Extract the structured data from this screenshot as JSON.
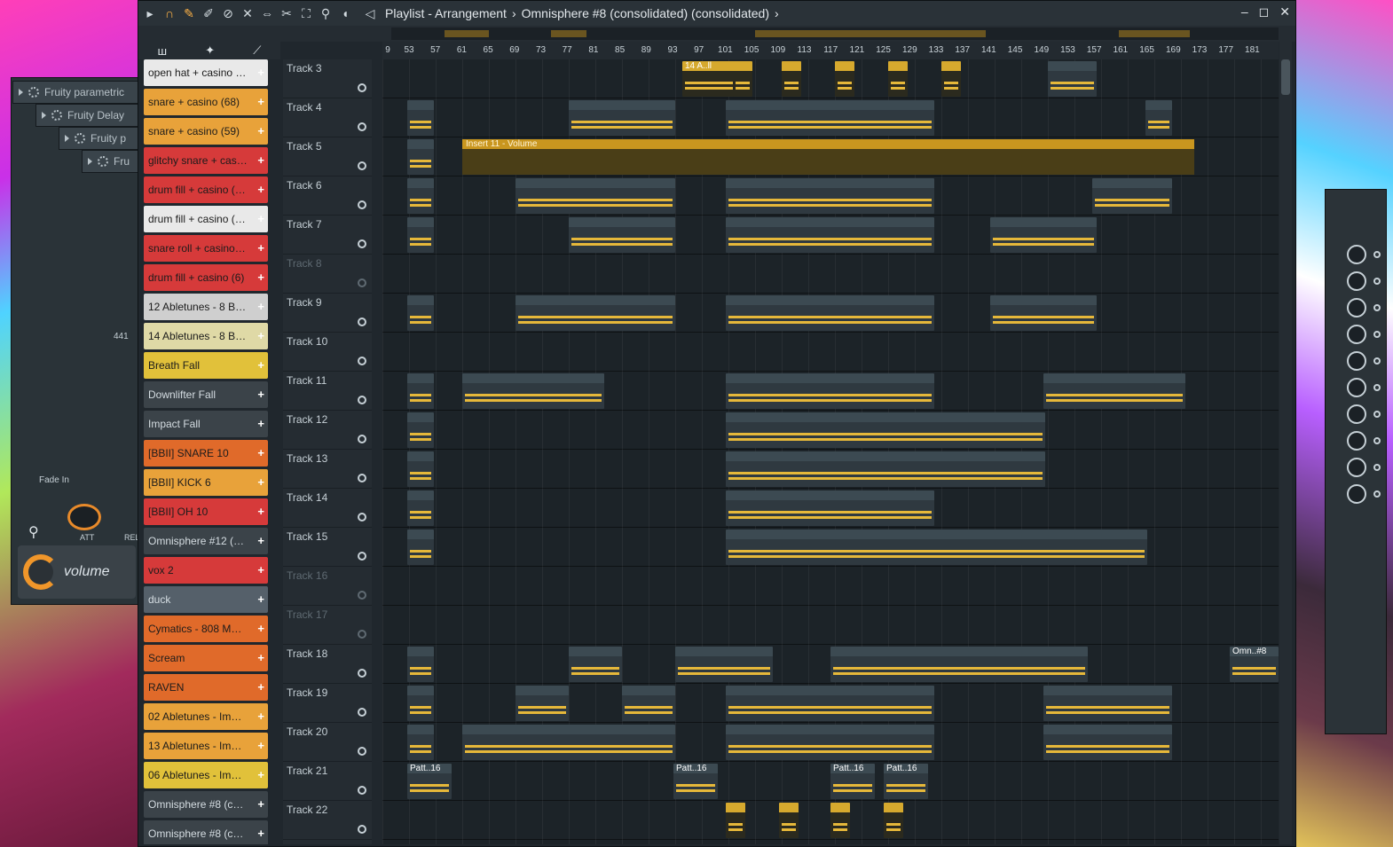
{
  "window": {
    "title": "Playlist - Arrangement",
    "breadcrumb_sep": "›",
    "pattern": "Omnisphere #8 (consolidated) (consolidated)",
    "controls": [
      "–",
      "◻",
      "✕"
    ]
  },
  "left_panels": {
    "plugins": [
      "Fruity parametric",
      "Fruity Delay",
      "Fruity p",
      "Fru"
    ],
    "fade_label": "Fade In",
    "knob_att": "ATT",
    "knob_rel": "REL",
    "sample_rate": "441",
    "volume_label": "volume"
  },
  "picker": {
    "header_icons": [
      "ш",
      "✦",
      "⟋"
    ],
    "items": [
      {
        "label": "open hat + casino (4...",
        "color": "#e9e9e9"
      },
      {
        "label": "snare + casino (68)",
        "color": "#e8a23a"
      },
      {
        "label": "snare + casino (59)",
        "color": "#e8a23a"
      },
      {
        "label": "glitchy snare + casin...",
        "color": "#d63a3a"
      },
      {
        "label": "drum fill + casino (25)",
        "color": "#d63a3a"
      },
      {
        "label": "drum fill + casino (23)",
        "color": "#e9e9e9"
      },
      {
        "label": "snare roll + casino (3)",
        "color": "#d63a3a"
      },
      {
        "label": "drum fill + casino (6)",
        "color": "#d63a3a"
      },
      {
        "label": "12 Abletunes - 8 Bar...",
        "color": "#cfcfcf"
      },
      {
        "label": "14 Abletunes - 8 Bar...",
        "color": "#dfd9a6"
      },
      {
        "label": "Breath Fall",
        "color": "#e1c13a"
      },
      {
        "label": "Downlifter Fall",
        "color": "#3b4349"
      },
      {
        "label": "Impact Fall",
        "color": "#3b4349"
      },
      {
        "label": "[BBII] SNARE 10",
        "color": "#e06a2a"
      },
      {
        "label": "[BBII] KICK 6",
        "color": "#e8a23a"
      },
      {
        "label": "[BBII] OH 10",
        "color": "#d63a3a"
      },
      {
        "label": "Omnisphere #12 (con...",
        "color": "#3b4349"
      },
      {
        "label": "vox 2",
        "color": "#d63a3a"
      },
      {
        "label": "duck",
        "color": "#55606a"
      },
      {
        "label": "Cymatics - 808 Mob...",
        "color": "#e06a2a"
      },
      {
        "label": "Scream",
        "color": "#e06a2a"
      },
      {
        "label": "RAVEN",
        "color": "#e06a2a"
      },
      {
        "label": "02 Abletunes - Impact",
        "color": "#e8a23a"
      },
      {
        "label": "13 Abletunes - Impact",
        "color": "#e8a23a"
      },
      {
        "label": "06 Abletunes - Impact",
        "color": "#e1c13a"
      },
      {
        "label": "Omnisphere #8 (cons...",
        "color": "#3b4349"
      },
      {
        "label": "Omnisphere #8 (cons...",
        "color": "#3b4349"
      }
    ]
  },
  "ruler": [
    "9",
    "53",
    "57",
    "61",
    "65",
    "69",
    "73",
    "77",
    "81",
    "85",
    "89",
    "93",
    "97",
    "101",
    "105",
    "109",
    "113",
    "117",
    "121",
    "125",
    "129",
    "133",
    "137",
    "141",
    "145",
    "149",
    "153",
    "157",
    "161",
    "165",
    "169",
    "173",
    "177",
    "181"
  ],
  "tracks": [
    {
      "label": "Track 3",
      "dim": false
    },
    {
      "label": "Track 4",
      "dim": false
    },
    {
      "label": "Track 5",
      "dim": false
    },
    {
      "label": "Track 6",
      "dim": false
    },
    {
      "label": "Track 7",
      "dim": false
    },
    {
      "label": "Track 8",
      "dim": true
    },
    {
      "label": "Track 9",
      "dim": false
    },
    {
      "label": "Track 10",
      "dim": false
    },
    {
      "label": "Track 11",
      "dim": false
    },
    {
      "label": "Track 12",
      "dim": false
    },
    {
      "label": "Track 13",
      "dim": false
    },
    {
      "label": "Track 14",
      "dim": false
    },
    {
      "label": "Track 15",
      "dim": false
    },
    {
      "label": "Track 16",
      "dim": true
    },
    {
      "label": "Track 17",
      "dim": true
    },
    {
      "label": "Track 18",
      "dim": false
    },
    {
      "label": "Track 19",
      "dim": false
    },
    {
      "label": "Track 20",
      "dim": false
    },
    {
      "label": "Track 21",
      "dim": false
    },
    {
      "label": "Track 22",
      "dim": false
    }
  ],
  "clip_labels": {
    "track3": "14 A..ll",
    "automation": "Insert 11 - Volume",
    "patt": "Patt..16",
    "omn": "Omn..#8"
  }
}
